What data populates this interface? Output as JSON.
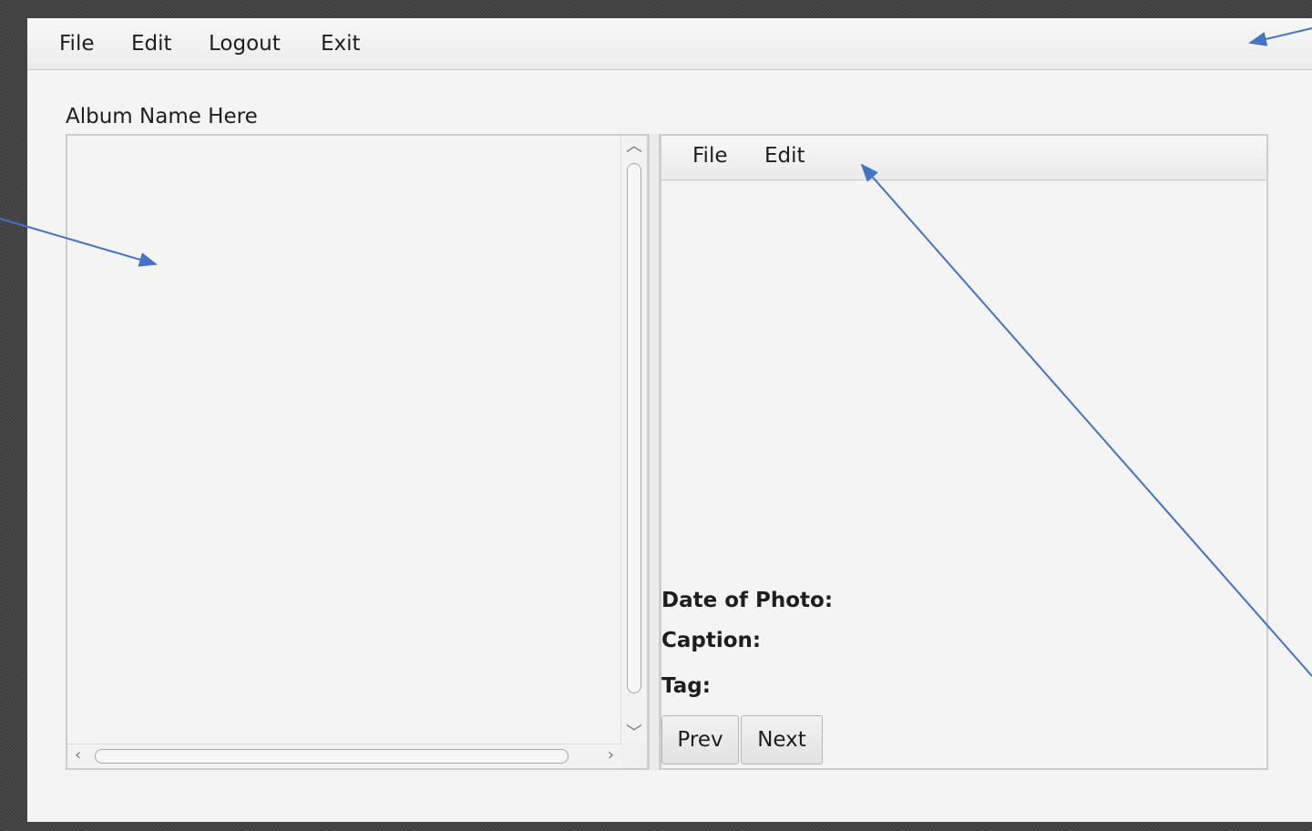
{
  "main_menu": {
    "items": [
      "File",
      "Edit",
      "Logout",
      "Exit"
    ]
  },
  "album": {
    "name_label": "Album Name Here"
  },
  "photo_panel": {
    "menu": [
      "File",
      "Edit"
    ],
    "date_label": "Date of Photo:",
    "caption_label": "Caption:",
    "tag_label": "Tag:",
    "prev_button": "Prev",
    "next_button": "Next"
  },
  "colors": {
    "annotation_arrow": "#4472c4",
    "window_background": "#f4f4f4"
  }
}
